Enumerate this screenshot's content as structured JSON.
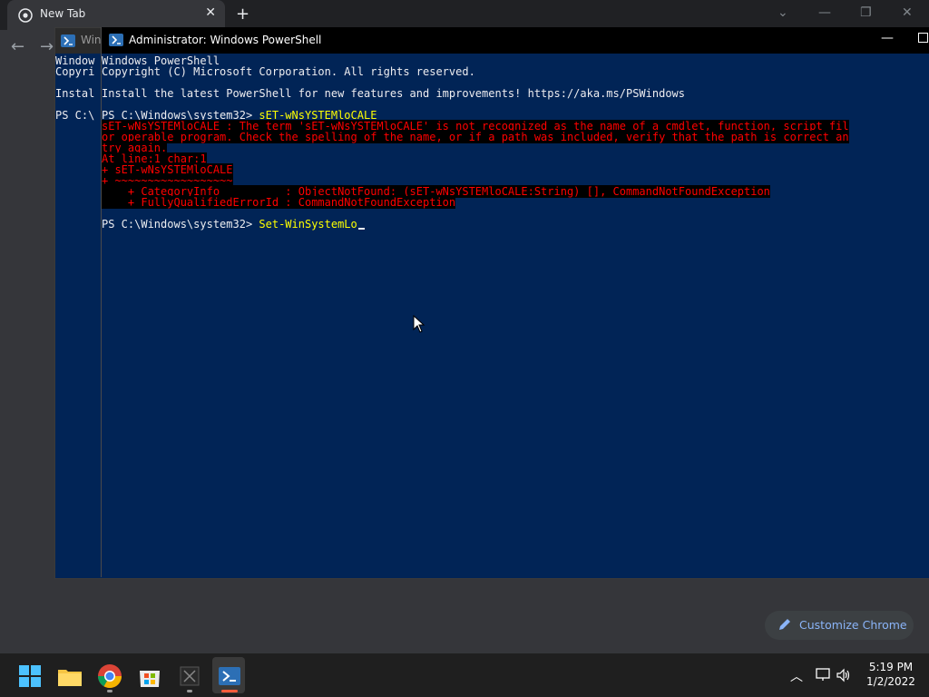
{
  "chrome": {
    "tab_title": "New Tab",
    "customize_label": "Customize Chrome"
  },
  "back_window": {
    "title": "Win",
    "lines": [
      "Window",
      "Copyri",
      "",
      "Instal",
      "",
      "PS C:\\"
    ]
  },
  "front_window": {
    "title": "Administrator: Windows PowerShell",
    "lines": [
      {
        "text": "Windows PowerShell",
        "style": "white"
      },
      {
        "text": "Copyright (C) Microsoft Corporation. All rights reserved.",
        "style": "white"
      },
      {
        "text": "",
        "style": "white"
      },
      {
        "text": "Install the latest PowerShell for new features and improvements! https://aka.ms/PSWindows",
        "style": "white"
      },
      {
        "text": "",
        "style": "white"
      },
      {
        "prompt": "PS C:\\Windows\\system32> ",
        "command": "sET-wNsYSTEMloCALE",
        "style": "prompt"
      },
      {
        "text": "sET-wNsYSTEMloCALE : The term 'sET-wNsYSTEMloCALE' is not recognized as the name of a cmdlet, function, script fil",
        "style": "err"
      },
      {
        "text": "or operable program. Check the spelling of the name, or if a path was included, verify that the path is correct an",
        "style": "err"
      },
      {
        "text": "try again.",
        "style": "err"
      },
      {
        "text": "At line:1 char:1",
        "style": "err"
      },
      {
        "text": "+ sET-wNsYSTEMloCALE",
        "style": "err"
      },
      {
        "text": "+ ~~~~~~~~~~~~~~~~~~",
        "style": "err"
      },
      {
        "text": "    + CategoryInfo          : ObjectNotFound: (sET-wNsYSTEMloCALE:String) [], CommandNotFoundException",
        "style": "err"
      },
      {
        "text": "    + FullyQualifiedErrorId : CommandNotFoundException",
        "style": "err"
      },
      {
        "text": "",
        "style": "white"
      },
      {
        "prompt": "PS C:\\Windows\\system32> ",
        "command": "Set-WinSystemLo",
        "style": "prompt"
      }
    ]
  },
  "taskbar": {
    "time": "5:19 PM",
    "date": "1/2/2022",
    "apps": [
      "start-icon",
      "file-explorer-icon",
      "chrome-icon",
      "microsoft-store-icon",
      "app-icon",
      "powershell-icon"
    ]
  }
}
